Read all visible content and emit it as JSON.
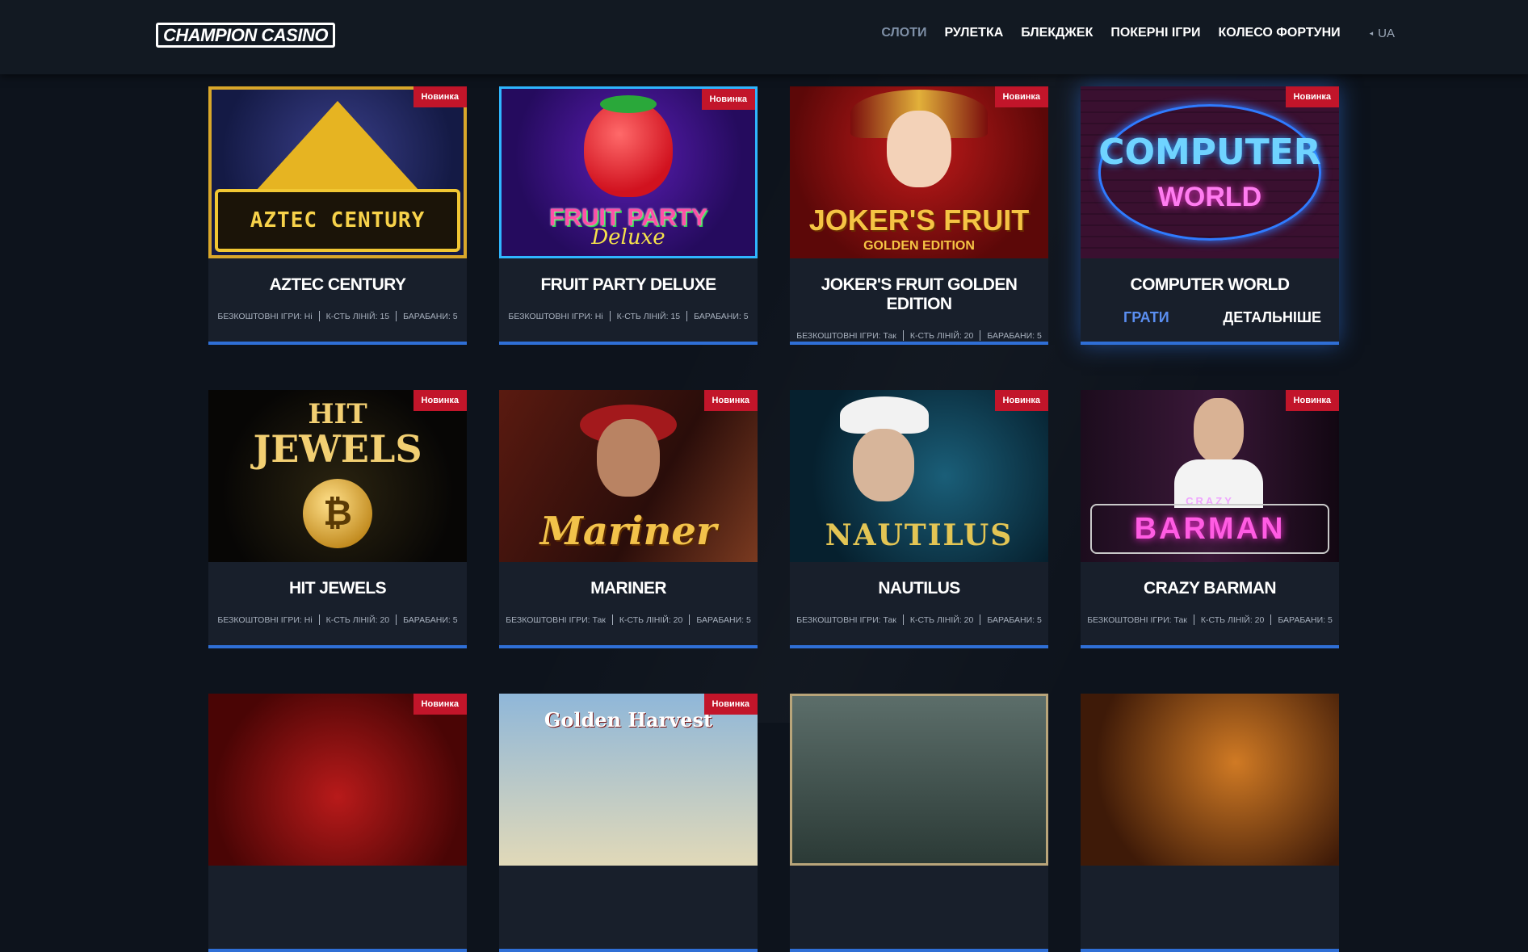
{
  "header": {
    "logo_text": "CHAMPION CASINO",
    "nav": [
      {
        "label": "СЛОТИ",
        "active": true
      },
      {
        "label": "РУЛЕТКА",
        "active": false
      },
      {
        "label": "БЛЕКДЖЕК",
        "active": false
      },
      {
        "label": "ПОКЕРНІ ІГРИ",
        "active": false
      },
      {
        "label": "КОЛЕСО ФОРТУНИ",
        "active": false
      }
    ],
    "language": "UA"
  },
  "colors": {
    "background": "#0d131c",
    "header_bg": "#121922",
    "card_bg": "#181f2b",
    "accent_blue": "#2f6fd6",
    "badge_red": "#c2152a",
    "nav_active": "#7e8fa6"
  },
  "labels": {
    "free_games": "БЕЗКОШТОВНІ ІГРИ:",
    "lines": "К-СТЬ ЛІНІЙ:",
    "reels": "БАРАБАНИ:",
    "play": "ГРАТИ",
    "details": "ДЕТАЛЬНІШЕ"
  },
  "games": [
    {
      "title": "AZTEC CENTURY",
      "badge": "Новинка",
      "free_games": "Ні",
      "lines": "15",
      "reels": "5",
      "art_text": "AZTEC CENTURY",
      "hover": false
    },
    {
      "title": "FRUIT PARTY DELUXE",
      "badge": "Новинка",
      "free_games": "Ні",
      "lines": "15",
      "reels": "5",
      "art_text": "FRUIT PARTY",
      "art_sub": "Deluxe",
      "hover": false
    },
    {
      "title": "JOKER'S FRUIT GOLDEN EDITION",
      "badge": "Новинка",
      "free_games": "Так",
      "lines": "20",
      "reels": "5",
      "art_text": "JOKER'S FRUIT",
      "art_sub": "GOLDEN EDITION",
      "hover": false
    },
    {
      "title": "COMPUTER WORLD",
      "badge": "Новинка",
      "art_text": "COMPUTER",
      "art_sub": "WORLD",
      "hover": true
    },
    {
      "title": "HIT JEWELS",
      "badge": "Новинка",
      "free_games": "Ні",
      "lines": "20",
      "reels": "5",
      "art_text": "HIT",
      "art_sub": "JEWELS",
      "hover": false
    },
    {
      "title": "MARINER",
      "badge": "Новинка",
      "free_games": "Так",
      "lines": "20",
      "reels": "5",
      "art_text": "Mariner",
      "hover": false
    },
    {
      "title": "NAUTILUS",
      "badge": "Новинка",
      "free_games": "Так",
      "lines": "20",
      "reels": "5",
      "art_text": "NAUTILUS",
      "hover": false
    },
    {
      "title": "CRAZY BARMAN",
      "badge": "Новинка",
      "free_games": "Так",
      "lines": "20",
      "reels": "5",
      "art_text": "BARMAN",
      "art_sub": "CRAZY",
      "art_small": "BARMAN",
      "hover": false
    },
    {
      "badge": "Новинка"
    },
    {
      "badge": "Новинка",
      "art_text": "Golden Harvest"
    },
    {},
    {}
  ]
}
